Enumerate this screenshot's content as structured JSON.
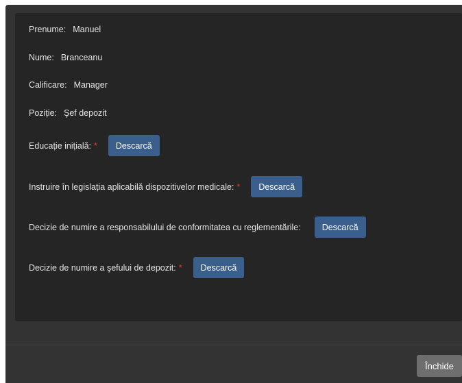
{
  "fields": {
    "first_name": {
      "label": "Prenume:",
      "value": "Manuel"
    },
    "last_name": {
      "label": "Nume:",
      "value": "Branceanu"
    },
    "qualification": {
      "label": "Calificare:",
      "value": "Manager"
    },
    "position": {
      "label": "Poziție:",
      "value": "Şef depozit"
    }
  },
  "documents": [
    {
      "label": "Educație inițială:",
      "required": "*",
      "button": "Descarcă"
    },
    {
      "label": "Instruire în legislația aplicabilă dispozitivelor medicale:",
      "required": "*",
      "button": "Descarcă"
    },
    {
      "label": "Decizie de numire a responsabilului de conformitatea cu reglementările:",
      "required": "",
      "button": "Descarcă"
    },
    {
      "label": "Decizie de numire a şefului de depozit:",
      "required": "*",
      "button": "Descarcă"
    }
  ],
  "footer": {
    "close_label": "Închide"
  },
  "colors": {
    "modal_bg": "#333333",
    "panel_bg": "#252525",
    "primary_button": "#3a5f8d",
    "secondary_button": "#6e6e6e",
    "required_marker": "#e53935"
  }
}
